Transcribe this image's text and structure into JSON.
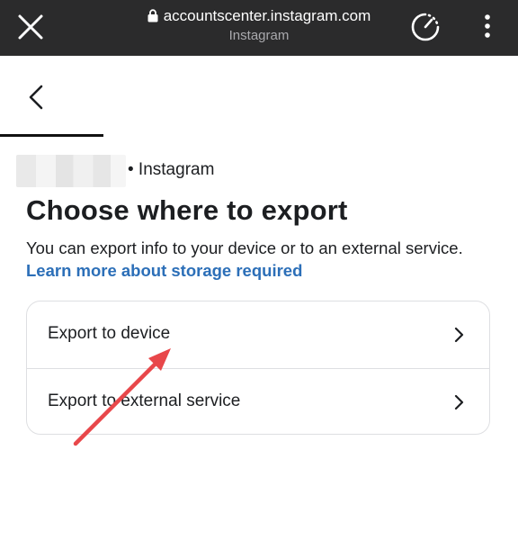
{
  "browser": {
    "url": "accountscenter.instagram.com",
    "site_name": "Instagram"
  },
  "account": {
    "platform_label": "• Instagram"
  },
  "page": {
    "title": "Choose where to export",
    "description": "You can export info to your device or to an external service. ",
    "link_text": "Learn more about storage required"
  },
  "options": [
    {
      "label": "Export to device"
    },
    {
      "label": "Export to external service"
    }
  ],
  "colors": {
    "topbar": "#2b2b2c",
    "link": "#2c6fb8",
    "annotation_arrow": "#e8474a"
  }
}
